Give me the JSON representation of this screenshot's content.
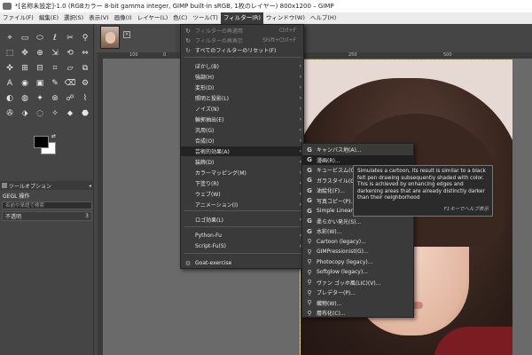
{
  "window": {
    "title": "*[名称未設定]-1.0 (RGBカラー 8-bit gamma integer, GIMP built-in sRGB, 1枚のレイヤー) 800x1200 – GIMP"
  },
  "menubar": [
    "ファイル(F)",
    "編集(E)",
    "選択(S)",
    "表示(V)",
    "画像(I)",
    "レイヤー(L)",
    "色(C)",
    "ツール(T)",
    "フィルター(R)",
    "ウィンドウ(W)",
    "ヘルプ(H)"
  ],
  "toolbox": {
    "tools": [
      "⌖",
      "▭",
      "⬭",
      "ℓ",
      "✂",
      "⚲",
      "⬚",
      "✥",
      "⊕",
      "⇲",
      "⟲",
      "⇔",
      "✜",
      "⊞",
      "⊟",
      "⌗",
      "▱",
      "⧉",
      "A",
      "◉",
      "▣",
      "✎",
      "⌫",
      "⚙",
      "◐",
      "◍",
      "✦",
      "⊛",
      "☍",
      "⌇",
      "✇",
      "⬗",
      "◌",
      "✧",
      "⬥",
      "⬣"
    ],
    "tab_label": "ツールオプション",
    "gegl_title": "GEGL 操作",
    "search_placeholder": "名前や単語で検索",
    "mode_label": "不透明",
    "mode_value": "3",
    "swap_icon": "swap-colors-icon"
  },
  "ruler": {
    "labels": [
      "100",
      "0",
      "250",
      "500",
      "750"
    ]
  },
  "filters_menu": {
    "items": [
      {
        "label": "フィルターの再適用",
        "shortcut": "Ctrl+F",
        "disabled": true,
        "icon": "repeat-icon"
      },
      {
        "label": "フィルターの再表示",
        "shortcut": "Shift+Ctrl+F",
        "disabled": true,
        "icon": "reshow-icon"
      },
      {
        "label": "すべてのフィルターのリセット(F)",
        "shortcut": "",
        "disabled": false,
        "icon": "reset-icon"
      },
      {
        "label": "ぼかし(B)",
        "submenu": true
      },
      {
        "label": "強調(H)",
        "submenu": true
      },
      {
        "label": "変形(D)",
        "submenu": true
      },
      {
        "label": "照明と投影(L)",
        "submenu": true
      },
      {
        "label": "ノイズ(N)",
        "submenu": true
      },
      {
        "label": "輪郭抽出(E)",
        "submenu": true
      },
      {
        "label": "汎用(G)",
        "submenu": true
      },
      {
        "label": "合成(O)",
        "submenu": true
      },
      {
        "label": "芸術的効果(A)",
        "submenu": true,
        "highlight": true
      },
      {
        "label": "装飾(D)",
        "submenu": true
      },
      {
        "label": "カラーマッピング(M)",
        "submenu": true
      },
      {
        "label": "下塗り(R)",
        "submenu": true
      },
      {
        "label": "ウェブ(W)",
        "submenu": true
      },
      {
        "label": "アニメーション(I)",
        "submenu": true
      },
      {
        "label": "ロゴ効果(L)",
        "submenu": true
      },
      {
        "label": "Python-Fu",
        "submenu": true
      },
      {
        "label": "Script-Fu(S)",
        "submenu": true
      },
      {
        "label": "Goat-exercise",
        "submenu": false,
        "icon": "goat-icon"
      }
    ]
  },
  "artistic_submenu": {
    "items": [
      {
        "label": "キャンバス地(A)...",
        "icon": "gegl-icon"
      },
      {
        "label": "漫画(R)...",
        "icon": "gegl-icon",
        "highlight": true
      },
      {
        "label": "キュービスム(C)...",
        "icon": "gegl-icon"
      },
      {
        "label": "ガラスタイル(G)...",
        "icon": "gegl-icon"
      },
      {
        "label": "油絵化(F)...",
        "icon": "gegl-icon"
      },
      {
        "label": "写真コピー(P)...",
        "icon": "gegl-icon"
      },
      {
        "label": "Simple Linear Iter...",
        "icon": "gegl-icon"
      },
      {
        "label": "柔らかい発光(S)...",
        "icon": "gegl-icon"
      },
      {
        "label": "水彩(W)...",
        "icon": "gegl-icon"
      },
      {
        "label": "Cartoon (legacy)...",
        "icon": "script-icon"
      },
      {
        "label": "GIMPressionist(G)...",
        "icon": "script-icon"
      },
      {
        "label": "Photocopy (legacy)...",
        "icon": "script-icon"
      },
      {
        "label": "Softglow (legacy)...",
        "icon": "script-icon"
      },
      {
        "label": "ヴァン ゴッホ風(LIC)(V)...",
        "icon": "script-icon"
      },
      {
        "label": "プレデター(P)...",
        "icon": "script-icon"
      },
      {
        "label": "織物(W)...",
        "icon": "script-icon"
      },
      {
        "label": "層布化(C)...",
        "icon": "script-icon"
      }
    ]
  },
  "tooltip": {
    "text": "Simulates a cartoon, its result is similar to a black felt pen drawing subsequently shaded with color. This is achieved by enhancing edges and darkening areas that are already distinctly darker than their neighborhood",
    "help": "F1キーでヘルプ表示"
  }
}
